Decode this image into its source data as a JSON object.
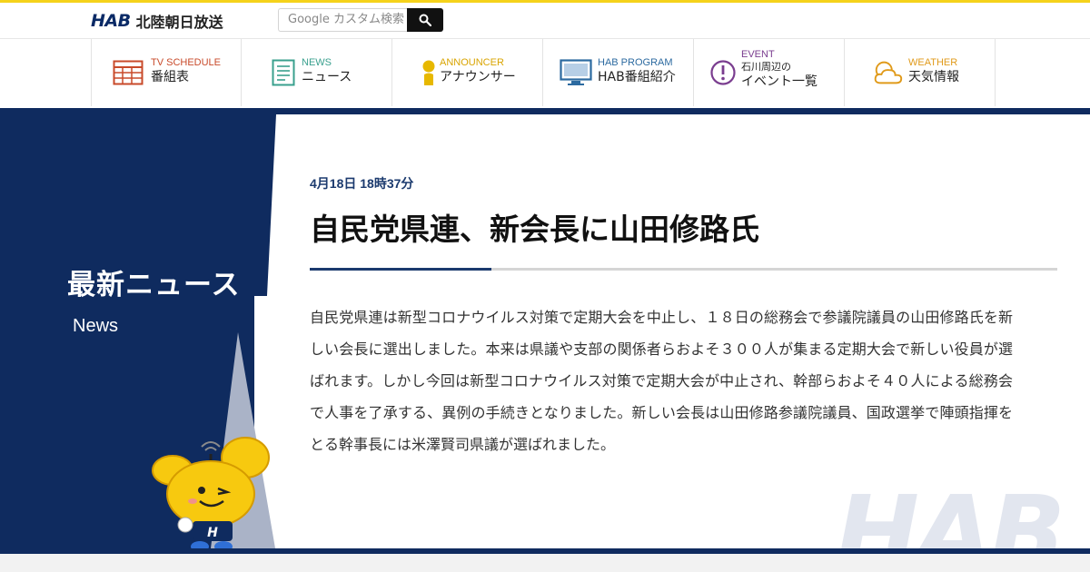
{
  "header": {
    "logo_mark": "HAB",
    "logo_name": "北陸朝日放送",
    "search_placeholder": "Google カスタム検索",
    "search_icon": "search-icon"
  },
  "nav": [
    {
      "en": "TV SCHEDULE",
      "ja": "番組表",
      "icon": "tv-schedule-icon",
      "color": "#c84a2a"
    },
    {
      "en": "NEWS",
      "ja": "ニュース",
      "icon": "news-document-icon",
      "color": "#3aa08e"
    },
    {
      "en": "ANNOUNCER",
      "ja": "アナウンサー",
      "icon": "announcer-person-icon",
      "color": "#d9a400"
    },
    {
      "en": "HAB PROGRAM",
      "ja": "HAB番組紹介",
      "icon": "monitor-icon",
      "color": "#2c6aa0"
    },
    {
      "en": "EVENT",
      "ja_line1": "石川周辺の",
      "ja_line2": "イベント一覧",
      "icon": "alert-circle-icon",
      "color": "#7a3d8f"
    },
    {
      "en": "WEATHER",
      "ja": "天気情報",
      "icon": "weather-cloud-icon",
      "color": "#e09a1a"
    }
  ],
  "side": {
    "title": "最新ニュース",
    "subtitle": "News"
  },
  "article": {
    "date": "4月18日 18時37分",
    "title": "自民党県連、新会長に山田修路氏",
    "body": "自民党県連は新型コロナウイルス対策で定期大会を中止し、１８日の総務会で参議院議員の山田修路氏を新しい会長に選出しました。本来は県議や支部の関係者らおよそ３００人が集まる定期大会で新しい役員が選ばれます。しかし今回は新型コロナウイルス対策で定期大会が中止され、幹部らおよそ４０人による総務会で人事を了承する、異例の手続きとなりました。新しい会長は山田修路参議院議員、国政選挙で陣頭指揮をとる幹事長には米澤賢司県議が選ばれました。"
  },
  "colors": {
    "navy": "#0f2b5f",
    "accent_yellow": "#f5d21b",
    "rule_blue": "#1b3a6e"
  }
}
